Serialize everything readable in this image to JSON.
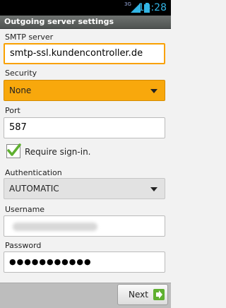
{
  "status_bar": {
    "time": "14:28",
    "network_label": "3G",
    "icons": [
      "signal-icon",
      "battery-icon"
    ]
  },
  "title_bar": {
    "title": "Outgoing server settings"
  },
  "form": {
    "smtp_label": "SMTP server",
    "smtp_value": "smtp-ssl.kundencontroller.de",
    "security_label": "Security",
    "security_value": "None",
    "port_label": "Port",
    "port_value": "587",
    "require_signin_label": "Require sign-in.",
    "require_signin_checked": true,
    "authentication_label": "Authentication",
    "authentication_value": "AUTOMATIC",
    "username_label": "Username",
    "password_label": "Password",
    "password_value": "●●●●●●●●●●●"
  },
  "footer": {
    "next_label": "Next",
    "next_icon": "arrow-right-icon"
  },
  "colors": {
    "accent": "#f8a80c",
    "status_blue": "#33b5e5",
    "check_green": "#5fb030"
  }
}
